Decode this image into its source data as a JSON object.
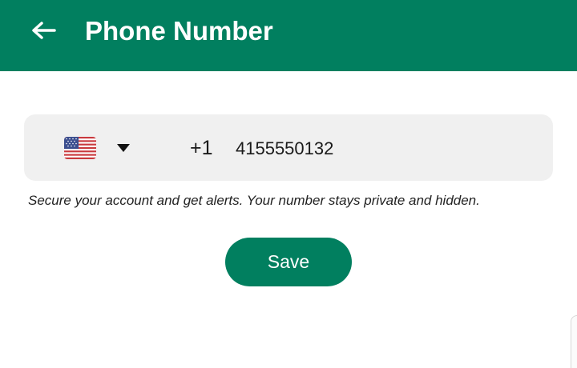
{
  "header": {
    "title": "Phone Number",
    "back_icon": "arrow-left-icon",
    "background_color": "#017f5f"
  },
  "phone": {
    "country_flag": "us-flag-icon",
    "dropdown_icon": "caret-down-icon",
    "dial_code": "+1",
    "number": "4155550132",
    "placeholder": ""
  },
  "helper_text": "Secure your account and get alerts. Your number stays private and hidden.",
  "actions": {
    "save_label": "Save",
    "accent_color": "#017f5f"
  }
}
